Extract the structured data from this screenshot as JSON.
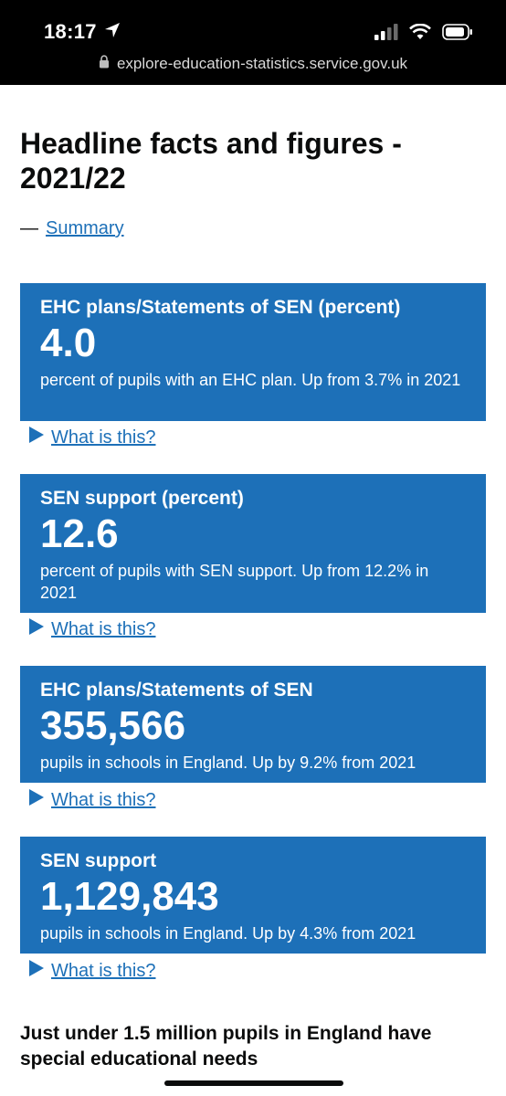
{
  "status_bar": {
    "time": "18:17",
    "url": "explore-education-statistics.service.gov.uk"
  },
  "page": {
    "title": "Headline facts and figures - 2021/22",
    "summary_dash": "—",
    "summary_link": "Summary"
  },
  "cards": [
    {
      "title": "EHC plans/Statements of SEN (percent)",
      "value": "4.0",
      "description": "percent of pupils with an EHC plan. Up from 3.7% in 2021",
      "details_label": "What is this?"
    },
    {
      "title": "SEN support (percent)",
      "value": "12.6",
      "description": "percent of pupils with SEN support. Up from 12.2% in 2021",
      "details_label": "What is this?"
    },
    {
      "title": "EHC plans/Statements of SEN",
      "value": "355,566",
      "description": "pupils in schools in England. Up by 9.2% from 2021",
      "details_label": "What is this?"
    },
    {
      "title": "SEN support",
      "value": "1,129,843",
      "description": "pupils in schools in England. Up by 4.3% from 2021",
      "details_label": "What is this?"
    }
  ],
  "bottom_heading": "Just under 1.5 million pupils in England have special educational needs",
  "colors": {
    "brand_blue": "#1d70b8",
    "text": "#0b0c0c",
    "status_bar_bg": "#000000"
  }
}
